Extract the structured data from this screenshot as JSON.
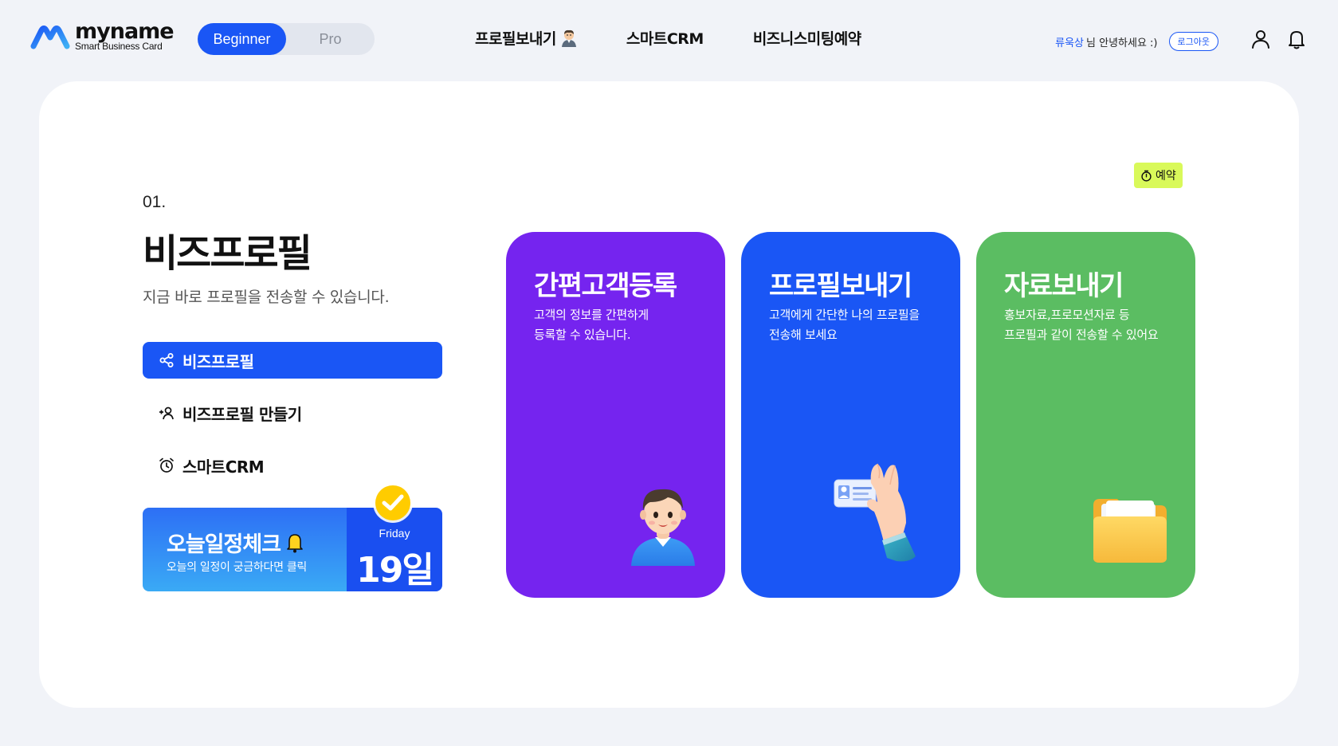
{
  "header": {
    "logo": {
      "name": "myname",
      "sub": "Smart Business Card"
    },
    "mode_toggle": {
      "beginner": "Beginner",
      "pro": "Pro",
      "selected": "Beginner"
    },
    "nav": [
      {
        "label": "프로필보내기",
        "icon": "person-emoji-icon"
      },
      {
        "label": "스마트CRM"
      },
      {
        "label": "비즈니스미팅예약"
      }
    ],
    "user": {
      "name": "류욱상",
      "greeting": "님 안녕하세요 :)",
      "logout": "로그아웃"
    },
    "icons": [
      "user-icon",
      "bell-icon"
    ]
  },
  "section": {
    "number": "01.",
    "title": "비즈프로필",
    "description": "지금 바로 프로필을 전송할 수 있습니다."
  },
  "menu": [
    {
      "label": "비즈프로필",
      "icon": "share-icon",
      "active": true
    },
    {
      "label": "비즈프로필 만들기",
      "icon": "add-user-icon",
      "active": false
    },
    {
      "label": "스마트CRM",
      "icon": "alarm-clock-icon",
      "active": false
    }
  ],
  "today": {
    "title": "오늘일정체크",
    "subtitle": "오늘의 일정이 궁금하다면 클릭",
    "day": "Friday",
    "date": "19일"
  },
  "reserve": {
    "label": "예약"
  },
  "cards": [
    {
      "title": "간편고객등록",
      "desc": "고객의 정보를 간편하게\n등록할 수 있습니다.",
      "color": "#7524ef",
      "illustration": "person-avatar"
    },
    {
      "title": "프로필보내기",
      "desc": "고객에게 간단한 나의 프로필을\n전송해 보세요",
      "color": "#1a56f5",
      "illustration": "hand-card"
    },
    {
      "title": "자료보내기",
      "desc": "홍보자료,프로모션자료 등\n프로필과 같이 전송할 수 있어요",
      "color": "#5bbd62",
      "illustration": "folder"
    }
  ],
  "colors": {
    "accent": "#1a56f5",
    "background": "#f1f3f8",
    "tag": "#d9f95a"
  }
}
